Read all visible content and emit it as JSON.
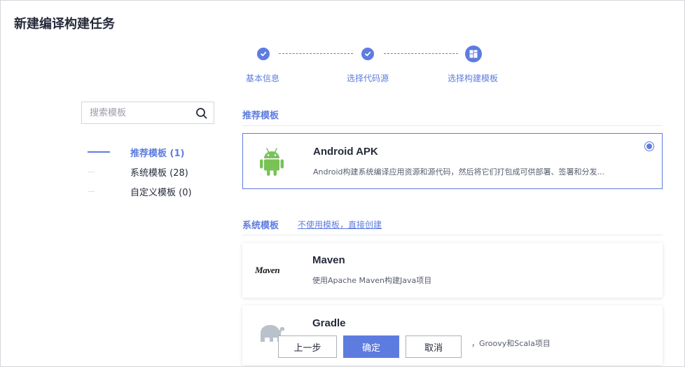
{
  "page_title": "新建编译构建任务",
  "stepper": {
    "steps": [
      {
        "label": "基本信息",
        "status": "done",
        "icon": "check-icon"
      },
      {
        "label": "选择代码源",
        "status": "done",
        "icon": "check-icon"
      },
      {
        "label": "选择构建模板",
        "status": "active",
        "icon": "template-grid-icon"
      }
    ]
  },
  "search": {
    "placeholder": "搜索模板",
    "value": ""
  },
  "categories": [
    {
      "label": "推荐模板 (1)",
      "active": true
    },
    {
      "label": "系统模板 (28)",
      "active": false
    },
    {
      "label": "自定义模板 (0)",
      "active": false
    }
  ],
  "recommended": {
    "title": "推荐模板",
    "cards": [
      {
        "title": "Android APK",
        "desc": "Android构建系统编译应用资源和源代码，然后将它们打包成可供部署、签署和分发...",
        "logo": "android-icon",
        "selected": true
      }
    ]
  },
  "system": {
    "title": "系统模板",
    "no_template_link": "不使用模板，直接创建",
    "cards": [
      {
        "title": "Maven",
        "desc": "使用Apache Maven构建Java项目",
        "logo": "maven-logo",
        "logo_text": "Maven"
      },
      {
        "title": "Gradle",
        "desc": "，Groovy和Scala项目",
        "logo": "gradle-elephant-icon"
      }
    ]
  },
  "footer": {
    "prev_label": "上一步",
    "confirm_label": "确定",
    "cancel_label": "取消"
  },
  "colors": {
    "accent": "#5e7ce0",
    "android_green": "#78c257",
    "text": "#252b3a"
  }
}
